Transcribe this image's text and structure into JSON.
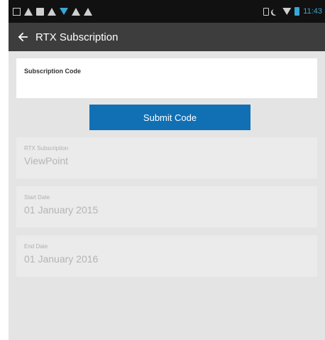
{
  "status_bar": {
    "time": "11:43",
    "left_icons": [
      "notification-icon",
      "warning-icon",
      "image-icon",
      "warning-icon",
      "wifi-icon",
      "warning-icon",
      "warning-icon"
    ],
    "right_icons": [
      "sim-icon",
      "moon-icon",
      "wifi-icon",
      "battery-icon"
    ]
  },
  "toolbar": {
    "title": "RTX Subscription",
    "back_icon": "arrow-left-icon"
  },
  "code_field": {
    "label": "Subscription Code",
    "value": ""
  },
  "submit_button": {
    "label": "Submit Code"
  },
  "details": {
    "subscription": {
      "label": "RTX Subscription",
      "value": "ViewPoint"
    },
    "start_date": {
      "label": "Start Date",
      "value": "01 January 2015"
    },
    "end_date": {
      "label": "End Date",
      "value": "01 January 2016"
    }
  },
  "colors": {
    "accent": "#1170b4",
    "toolbar": "#3d3d3d",
    "status_bar": "#111111",
    "status_accent": "#3aa6d6",
    "background": "#e4e4e4"
  }
}
